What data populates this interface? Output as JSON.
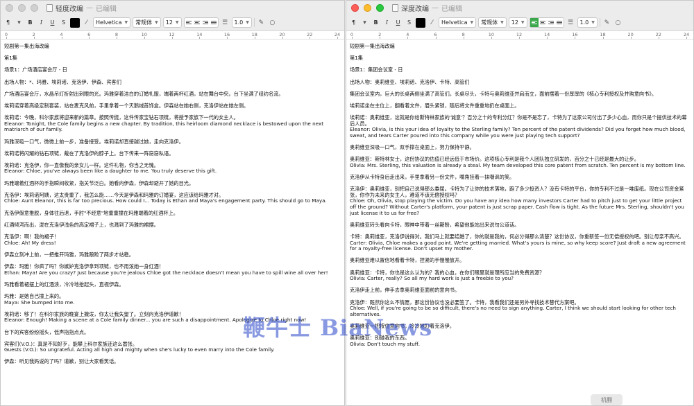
{
  "left_window": {
    "title": "轻度改编",
    "separator": "—",
    "status": "已编辑",
    "toolbar": {
      "paragraph_style": "¶",
      "bold": "B",
      "italic": "I",
      "underline": "U",
      "strike": "S",
      "text_color": "#000000",
      "font": "Helvetica",
      "weight": "常规体",
      "size": "12",
      "align_active": "left",
      "line_spacing": "1.0"
    },
    "ruler": [
      "0",
      "2",
      "4",
      "6",
      "8",
      "10",
      "12",
      "14",
      "16",
      "18",
      "20",
      "22",
      "24"
    ],
    "lines": [
      "短剧第一集出海改编",
      "第1集",
      "场景1：广场酒店宴会厅 - 日",
      "出场人物：*、玛雅、埃莉诺、克洛伊、伊森、宾客们",
      "广场酒店宴会厅，水晶吊灯折射出刺眼的光。玛雅穿着洁白的订婚礼服，端着两杯红酒，站在舞台中央。台下坐满了纽约名流。",
      "埃莉诺穿着高级定制套装，站在麦克风前，手里拿着一个天鹅绒首饰盒。伊森站在她右侧，克洛伊站在她左侧。",
      "埃莉诺：今晚，科尔家族将迎来新的篇章。按照传统，这件传家宝钻石项链，将授予家族下一代的女主人。\nEleanor: Tonight, the Cole family begins a new chapter. By tradition, this heirloom diamond necklace is bestowed upon the next matriarch of our family.",
      "玛雅深吸一口气，微微上前一步，准备接受。埃莉诺却直接越过她，走向克洛伊。",
      "埃莉诺将闪耀的钻石项链，戴在了克洛伊的脖子上。台下传来一阵窃窃私语。",
      "埃莉诺：克洛伊，你一直像我的亲女儿一样。这件礼物，你当之无愧。\nEleanor: Chloe, you've always been like a daughter to me. You truly deserve this gift.",
      "玛雅端着红酒杯的手指瞬间收紧，指关节泛白。她看向伊森，伊森却避开了她的目光。",
      "克洛伊：埃莉诺阿姨，这太贵重了，我怎么能……今天是伊森和玛雅的订婚宴，这应该给玛雅才对。\nChloe: Aunt Eleanor, this is far too precious. How could I... Today is Ethan and Maya's engagement party. This should go to Maya.",
      "克洛伊假意推脱，身体往后退，手肘\"不经意\"地重重撞在玛雅端着的红酒杯上。",
      "红酒倾泻而出，泼在克洛伊浅色的高定裙子上，也溅到了玛雅的裙摆。",
      "克洛伊：啊！我的裙子！\nChloe: Ah! My dress!",
      "伊森立刻冲上前，一把推开玛雅，玛雅踉跄了两步才站稳。",
      "伊森：玛雅！你疯了吗？你嫉妒克洛伊拿到项链，也不用泼她一身红酒！\nEthan: Maya! Are you crazy? Just because you're jealous Chloe got the necklace doesn't mean you have to spill wine all over her!",
      "玛雅看着裙摆上的红酒渍，冷冷地抬起头，直视伊森。",
      "玛雅：是她自己撞上来的。\nMaya: She bumped into me.",
      "埃莉诺：够了！在科尔家族的晚宴上撒泼，你太让我失望了。立刻向克洛伊道歉！\nEleanor: Enough! Making a scene at a Cole family dinner... you are such a disappointment. Apologize to Chloe right now!",
      "台下的宾客纷纷摇头，低声指指点点。",
      "宾客们(V.O.)：真是不知好歹，能攀上科尔家族还这么嚣张。\nGuests (V.O.): So ungrateful. Acting all high and mighty when she's lucky to even marry into the Cole family.",
      "伊森：听见我妈说的了吗？道歉，别让大家看笑话。"
    ]
  },
  "right_window": {
    "title": "深度改编",
    "separator": "—",
    "status": "已编辑",
    "toolbar": {
      "paragraph_style": "¶",
      "bold": "B",
      "italic": "I",
      "underline": "U",
      "strike": "S",
      "text_color": "#000000",
      "font": "Helvetica",
      "weight": "常规体",
      "size": "12",
      "align_active": "left",
      "line_spacing": "1.0"
    },
    "ruler": [
      "0",
      "2",
      "4",
      "6",
      "8",
      "10",
      "12",
      "14",
      "16",
      "18",
      "20",
      "22",
      "24"
    ],
    "lines": [
      "短剧第一集出海改编",
      "第1集",
      "场景1：集团会议室 - 日",
      "出场人物：奥莉维亚、埃莉诺、克洛伊、卡特、高管们",
      "集团会议室内，巨大的长桌两侧坐满了高管们。长桌尽头，卡特与奥莉维亚并肩而立，面前摆着一份厚厚的《核心专利授权及并购意向书》。",
      "埃莉诺坐在主位上，翻看着文件，眉头紧锁，随后将文件重重地扔在桌面上。",
      "埃莉诺：奥莉维亚，这就是你给斯特林家族的'诚意'？百分之十的专利分红？你是不是忘了，卡特为了这家公司付出了多少心血，而你只是个提供技术的幕后人员。\nEleanor: Olivia, is this your idea of loyalty to the Sterling family? Ten percent of the patent dividends? Did you forget how much blood, sweat, and tears Carter poured into this company while you were just playing tech support?",
      "奥莉维亚深吸一口气，双手撑在桌面上，努力保持平静。",
      "奥莉维亚：斯特林女士，这份协议的估值已经远低于市场价。这项核心专利是我个人团队独立研发的，百分之十已经是最大的让步。\nOlivia: Mrs. Sterling, this valuation is already a steal. My team developed this core patent from scratch. Ten percent is my bottom line.",
      "克洛伊从卡特身后走出来，手里拿着另一份文件，嘴角挂着一抹嘲讽的笑。",
      "克洛伊：奥莉维亚，别把自己说得那么委屈。卡特为了让你的技术落地，跑了多少投资人？没有卡特的平台，你的专利不过是一堆废纸。现在公司资金紧张，你作为未来的女主人，难道不该无偿授权吗？\nChloe: Oh, Olivia, stop playing the victim. Do you have any idea how many investors Carter had to pitch just to get your little project off the ground? Without Carter's platform, your patent is just scrap paper. Cash flow is tight. As the future Mrs. Sterling, shouldn't you just license it to us for free?",
      "奥莉维亚转头看向卡特，眼神中带着一丝期盼，希望他能站出来说句公道话。",
      "卡特：奥莉维亚，克洛伊说得对。我们马上就要结婚了，你的就是我的，何必分得那么清楚？这份协议，你重新签一份无偿授权的吧。别让母亲不高兴。\nCarter: Olivia, Chloe makes a good point. We're getting married. What's yours is mine, so why keep score? Just draft a new agreement for a royalty-free license. Don't upset my mother.",
      "奥莉维亚难以置信地看着卡特，捏紧的手慢慢放开。",
      "奥莉维亚：卡特，你也是这么认为的？我的心血，在你们眼里就是理所应当的免费资源？\nOlivia: Carter, really? So all my hard work is just a freebie to you?",
      "克洛伊走上前，伸手去拿奥莉维亚面前的意向书。",
      "克洛伊：既然你这么不情愿，那这份协议也没必要签了。卡特，我看我们还是另外寻找技术替代方案吧。\nChloe: Well, if you're going to be so difficult, there's no need to sign anything. Carter, I think we should start looking for other tech alternatives.",
      "奥莉维亚一把按住意向书，冷冷地盯着克洛伊。",
      "奥莉维亚：别碰我的东西。\nOlivia: Don't touch my stuff."
    ]
  },
  "watermark": "鞭牛士 BiaNews",
  "caption_button": "机翻"
}
